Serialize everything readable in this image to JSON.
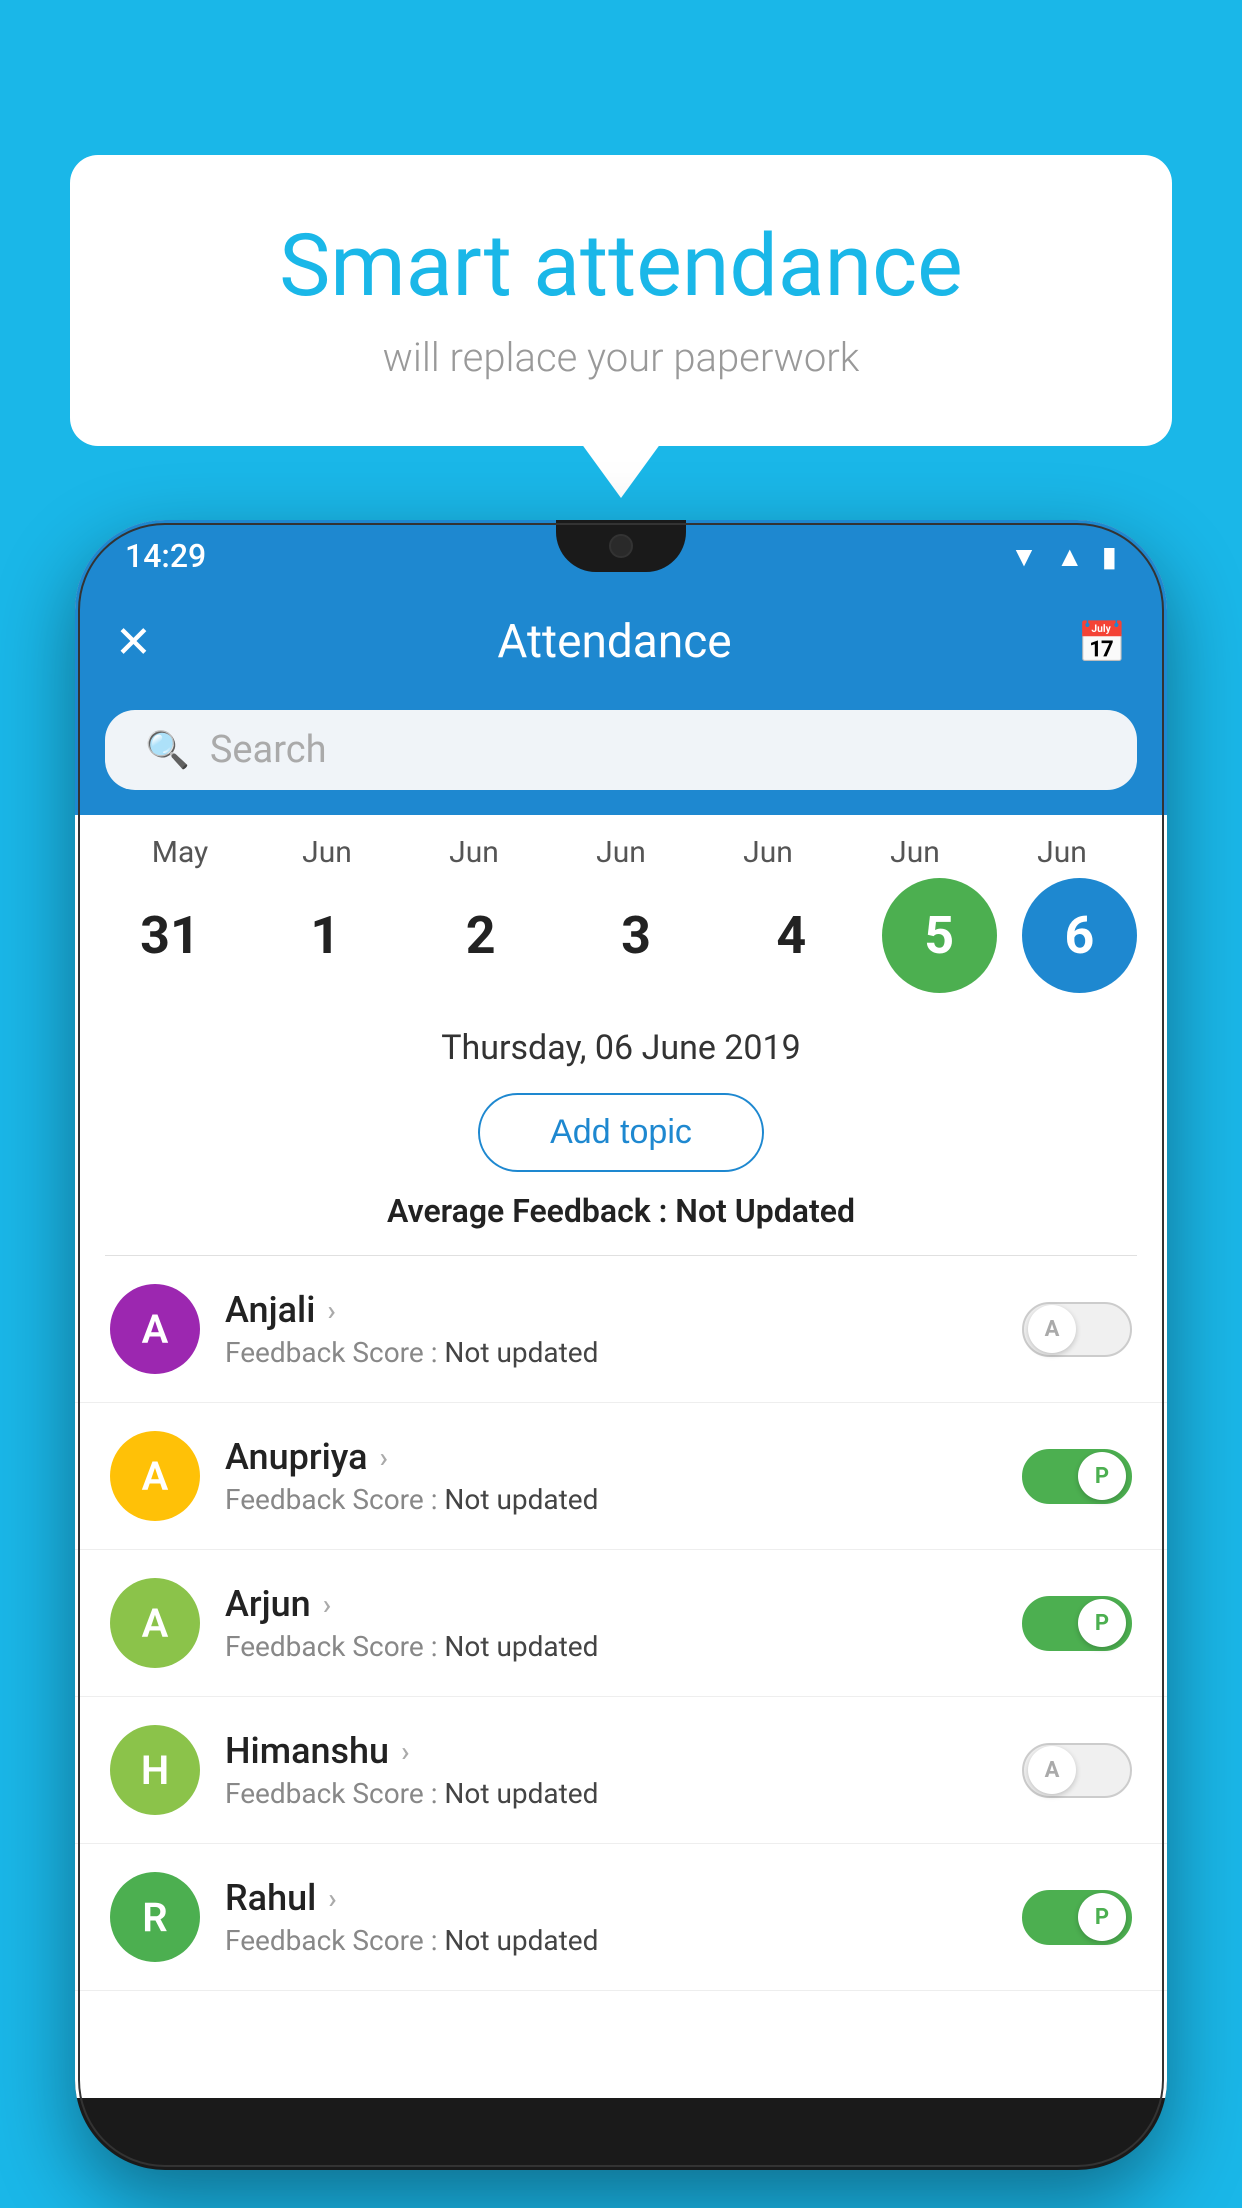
{
  "background_color": "#1ab7e8",
  "speech_bubble": {
    "title": "Smart attendance",
    "subtitle": "will replace your paperwork"
  },
  "status_bar": {
    "time": "14:29",
    "signal_icon": "▲",
    "wifi_icon": "▼",
    "battery_icon": "▮"
  },
  "app_bar": {
    "title": "Attendance",
    "close_label": "✕",
    "calendar_icon": "📅"
  },
  "search": {
    "placeholder": "Search"
  },
  "calendar": {
    "months": [
      "May",
      "Jun",
      "Jun",
      "Jun",
      "Jun",
      "Jun",
      "Jun"
    ],
    "days": [
      "31",
      "1",
      "2",
      "3",
      "4",
      "5",
      "6"
    ],
    "today_index": 5,
    "selected_index": 6
  },
  "selected_date": "Thursday, 06 June 2019",
  "add_topic_label": "Add topic",
  "avg_feedback_label": "Average Feedback :",
  "avg_feedback_value": "Not Updated",
  "students": [
    {
      "name": "Anjali",
      "avatar_letter": "A",
      "avatar_color": "#9c27b0",
      "feedback_label": "Feedback Score :",
      "feedback_value": "Not updated",
      "attendance": "A",
      "toggle_state": "off"
    },
    {
      "name": "Anupriya",
      "avatar_letter": "A",
      "avatar_color": "#ffc107",
      "feedback_label": "Feedback Score :",
      "feedback_value": "Not updated",
      "attendance": "P",
      "toggle_state": "on"
    },
    {
      "name": "Arjun",
      "avatar_letter": "A",
      "avatar_color": "#8bc34a",
      "feedback_label": "Feedback Score :",
      "feedback_value": "Not updated",
      "attendance": "P",
      "toggle_state": "on"
    },
    {
      "name": "Himanshu",
      "avatar_letter": "H",
      "avatar_color": "#8bc34a",
      "feedback_label": "Feedback Score :",
      "feedback_value": "Not updated",
      "attendance": "A",
      "toggle_state": "off"
    },
    {
      "name": "Rahul",
      "avatar_letter": "R",
      "avatar_color": "#4caf50",
      "feedback_label": "Feedback Score :",
      "feedback_value": "Not updated",
      "attendance": "P",
      "toggle_state": "on"
    }
  ]
}
